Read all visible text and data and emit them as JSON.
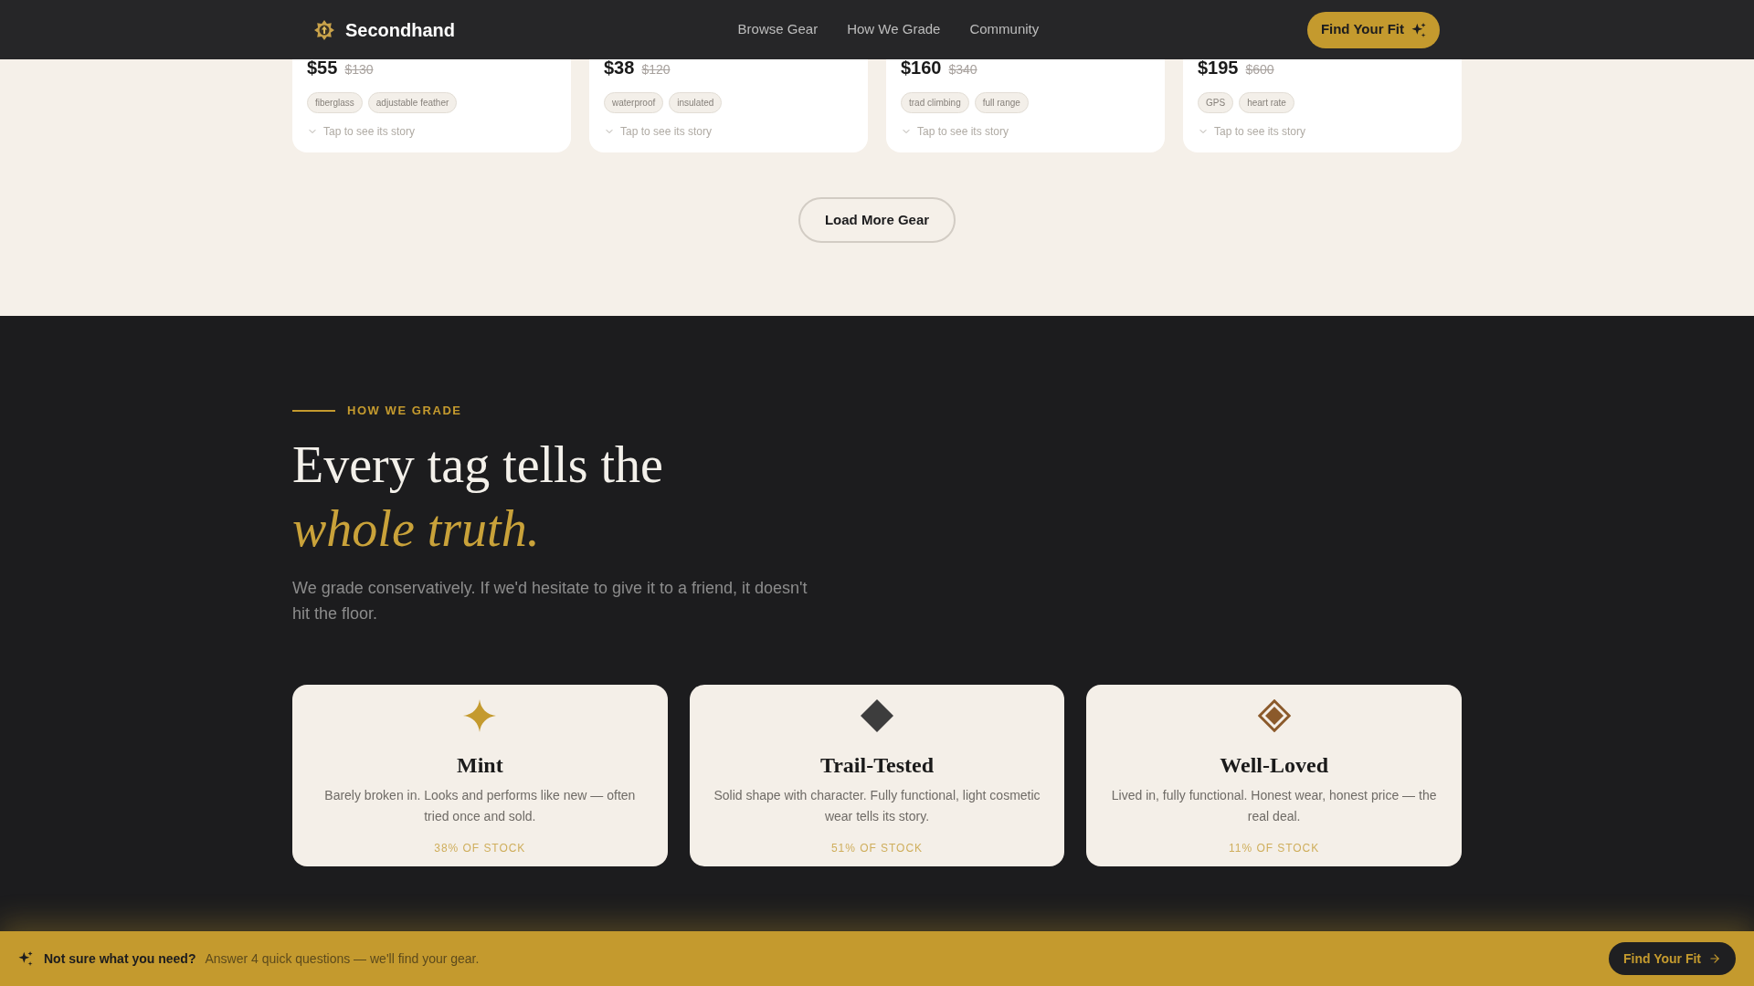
{
  "nav": {
    "brand": "Secondhand",
    "links": [
      "Browse Gear",
      "How We Grade",
      "Community"
    ],
    "cta": "Find Your Fit"
  },
  "products": [
    {
      "price": "$55",
      "old_price": "$130",
      "tags": [
        "fiberglass",
        "adjustable feather"
      ],
      "story_hint": "Tap to see its story"
    },
    {
      "price": "$38",
      "old_price": "$120",
      "tags": [
        "waterproof",
        "insulated"
      ],
      "story_hint": "Tap to see its story"
    },
    {
      "price": "$160",
      "old_price": "$340",
      "tags": [
        "trad climbing",
        "full range"
      ],
      "story_hint": "Tap to see its story"
    },
    {
      "price": "$195",
      "old_price": "$600",
      "tags": [
        "GPS",
        "heart rate"
      ],
      "story_hint": "Tap to see its story"
    }
  ],
  "load_more": "Load More Gear",
  "grading": {
    "eyebrow": "HOW WE GRADE",
    "heading": "Every tag tells the",
    "heading_accent": "whole truth.",
    "intro": "We grade conservatively. If we'd hesitate to give it to a friend, it doesn't hit the floor.",
    "grades": [
      {
        "kind": "sparkle",
        "color": "#c49a2e",
        "name": "Mint",
        "description": "Barely broken in. Looks and performs like new — often tried once and sold.",
        "share": "38% OF STOCK"
      },
      {
        "kind": "diamond",
        "color": "#3d3d3d",
        "name": "Trail-Tested",
        "description": "Solid shape with character. Fully functional, light cosmetic wear tells its story.",
        "share": "51% OF STOCK"
      },
      {
        "kind": "framed",
        "color": "#8b5a2b",
        "name": "Well-Loved",
        "description": "Lived in, fully functional. Honest wear, honest price — the real deal.",
        "share": "11% OF STOCK"
      }
    ]
  },
  "prompt_bar": {
    "title": "Not sure what you need?",
    "text": "Answer 4 quick questions — we'll find your gear.",
    "button": "Find Your Fit"
  }
}
